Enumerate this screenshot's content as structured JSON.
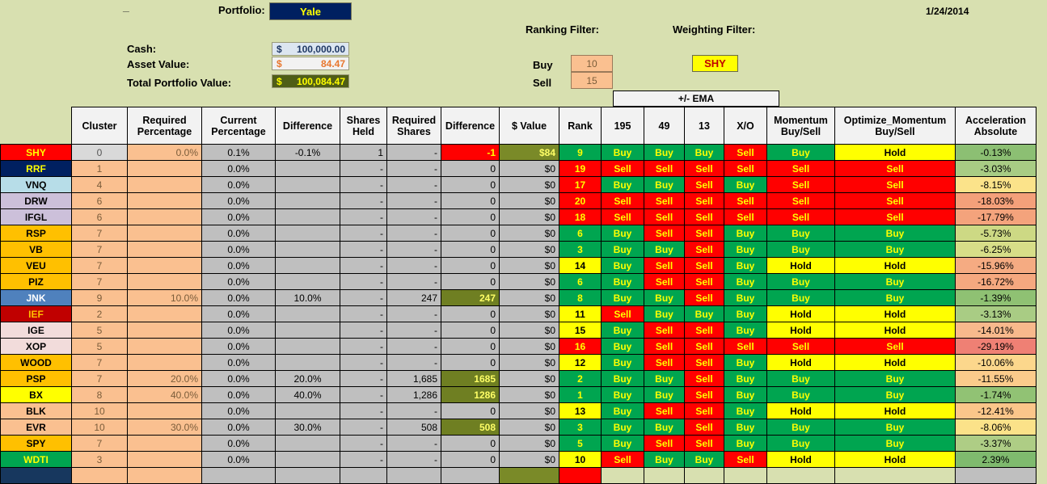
{
  "header": {
    "dash": "_",
    "portfolio_label": "Portfolio:",
    "portfolio_name": "Yale",
    "date": "1/24/2014",
    "cash_label": "Cash:",
    "cash_currency": "$",
    "cash_value": "100,000.00",
    "asset_label": "Asset Value:",
    "asset_currency": "$",
    "asset_value": "84.47",
    "total_label": "Total Portfolio Value:",
    "total_currency": "$",
    "total_value": "100,084.47",
    "ranking_filter_label": "Ranking Filter:",
    "weighting_filter_label": "Weighting Filter:",
    "buy_label": "Buy",
    "buy_value": "10",
    "sell_label": "Sell",
    "sell_value": "15",
    "weighting_filter_value": "SHY"
  },
  "table": {
    "group_header_ema": "+/- EMA",
    "columns": [
      "",
      "Cluster",
      "Required\nPercentage",
      "Current\nPercentage",
      "Difference",
      "Shares\nHeld",
      "Required\nShares",
      "Difference",
      "$ Value",
      "Rank",
      "195",
      "49",
      "13",
      "X/O",
      "Momentum\nBuy/Sell",
      "Optimize_Momentum\nBuy/Sell",
      "Acceleration\nAbsolute"
    ],
    "columns_flat": {
      "ticker": "",
      "cluster": "Cluster",
      "required_percentage_l1": "Required",
      "required_percentage_l2": "Percentage",
      "current_percentage_l1": "Current",
      "current_percentage_l2": "Percentage",
      "difference_pct": "Difference",
      "shares_held_l1": "Shares",
      "shares_held_l2": "Held",
      "required_shares_l1": "Required",
      "required_shares_l2": "Shares",
      "difference_shares": "Difference",
      "dollar_value": "$ Value",
      "rank": "Rank",
      "ema195": "195",
      "ema49": "49",
      "ema13": "13",
      "xo": "X/O",
      "momentum_l1": "Momentum",
      "momentum_l2": "Buy/Sell",
      "optimize_momentum_l1": "Optimize_Momentum",
      "optimize_momentum_l2": "Buy/Sell",
      "acceleration_l1": "Acceleration",
      "acceleration_l2": "Absolute"
    },
    "rows": [
      {
        "ticker": "SHY",
        "ticker_bg": "#ff0000",
        "ticker_fg": "#ffff00",
        "cluster": "0",
        "cluster_sel": true,
        "req_pct": "0.0%",
        "cur_pct": "0.1%",
        "diff_pct": "-0.1%",
        "shares_held": "1",
        "req_shares": "-",
        "diff_shares": "-1",
        "diff_shares_style": "red",
        "value": "$84",
        "value_style": "olive",
        "rank": "9",
        "rank_color": "g",
        "ema195": "Buy",
        "ema49": "Buy",
        "ema13": "Buy",
        "xo": "Sell",
        "momentum": "Buy",
        "opt_momentum": "Hold",
        "accel": "-0.13%",
        "accel_bg": "#8cbf73"
      },
      {
        "ticker": "RRF",
        "ticker_bg": "#002060",
        "ticker_fg": "#ffff00",
        "cluster": "1",
        "req_pct": "",
        "cur_pct": "0.0%",
        "diff_pct": "",
        "shares_held": "-",
        "req_shares": "-",
        "diff_shares": "0",
        "value": "$0",
        "rank": "19",
        "rank_color": "r",
        "ema195": "Sell",
        "ema49": "Sell",
        "ema13": "Sell",
        "xo": "Sell",
        "momentum": "Sell",
        "opt_momentum": "Sell",
        "accel": "-3.03%",
        "accel_bg": "#a8cc84"
      },
      {
        "ticker": "VNQ",
        "ticker_bg": "#b7dde8",
        "ticker_fg": "#000000",
        "cluster": "4",
        "req_pct": "",
        "cur_pct": "0.0%",
        "diff_pct": "",
        "shares_held": "-",
        "req_shares": "-",
        "diff_shares": "0",
        "value": "$0",
        "rank": "17",
        "rank_color": "r",
        "ema195": "Buy",
        "ema49": "Buy",
        "ema13": "Sell",
        "xo": "Buy",
        "momentum": "Sell",
        "opt_momentum": "Sell",
        "accel": "-8.15%",
        "accel_bg": "#fbe38a"
      },
      {
        "ticker": "DRW",
        "ticker_bg": "#ccc0da",
        "ticker_fg": "#000000",
        "cluster": "6",
        "req_pct": "",
        "cur_pct": "0.0%",
        "diff_pct": "",
        "shares_held": "-",
        "req_shares": "-",
        "diff_shares": "0",
        "value": "$0",
        "rank": "20",
        "rank_color": "r",
        "ema195": "Sell",
        "ema49": "Sell",
        "ema13": "Sell",
        "xo": "Sell",
        "momentum": "Sell",
        "opt_momentum": "Sell",
        "accel": "-18.03%",
        "accel_bg": "#f4a07a"
      },
      {
        "ticker": "IFGL",
        "ticker_bg": "#ccc0da",
        "ticker_fg": "#000000",
        "cluster": "6",
        "req_pct": "",
        "cur_pct": "0.0%",
        "diff_pct": "",
        "shares_held": "-",
        "req_shares": "-",
        "diff_shares": "0",
        "value": "$0",
        "rank": "18",
        "rank_color": "r",
        "ema195": "Sell",
        "ema49": "Sell",
        "ema13": "Sell",
        "xo": "Sell",
        "momentum": "Sell",
        "opt_momentum": "Sell",
        "accel": "-17.79%",
        "accel_bg": "#f4a37c"
      },
      {
        "ticker": "RSP",
        "ticker_bg": "#ffc000",
        "ticker_fg": "#000000",
        "cluster": "7",
        "req_pct": "",
        "cur_pct": "0.0%",
        "diff_pct": "",
        "shares_held": "-",
        "req_shares": "-",
        "diff_shares": "0",
        "value": "$0",
        "rank": "6",
        "rank_color": "g",
        "ema195": "Buy",
        "ema49": "Sell",
        "ema13": "Sell",
        "xo": "Buy",
        "momentum": "Buy",
        "opt_momentum": "Buy",
        "accel": "-5.73%",
        "accel_bg": "#cdd984"
      },
      {
        "ticker": "VB",
        "ticker_bg": "#ffc000",
        "ticker_fg": "#000000",
        "cluster": "7",
        "req_pct": "",
        "cur_pct": "0.0%",
        "diff_pct": "",
        "shares_held": "-",
        "req_shares": "-",
        "diff_shares": "0",
        "value": "$0",
        "rank": "3",
        "rank_color": "g",
        "ema195": "Buy",
        "ema49": "Buy",
        "ema13": "Sell",
        "xo": "Buy",
        "momentum": "Buy",
        "opt_momentum": "Buy",
        "accel": "-6.25%",
        "accel_bg": "#d7de88"
      },
      {
        "ticker": "VEU",
        "ticker_bg": "#ffc000",
        "ticker_fg": "#000000",
        "cluster": "7",
        "req_pct": "",
        "cur_pct": "0.0%",
        "diff_pct": "",
        "shares_held": "-",
        "req_shares": "-",
        "diff_shares": "0",
        "value": "$0",
        "rank": "14",
        "rank_color": "y",
        "ema195": "Buy",
        "ema49": "Sell",
        "ema13": "Sell",
        "xo": "Buy",
        "momentum": "Hold",
        "opt_momentum": "Hold",
        "accel": "-15.96%",
        "accel_bg": "#f5ab82"
      },
      {
        "ticker": "PIZ",
        "ticker_bg": "#ffc000",
        "ticker_fg": "#000000",
        "cluster": "7",
        "req_pct": "",
        "cur_pct": "0.0%",
        "diff_pct": "",
        "shares_held": "-",
        "req_shares": "-",
        "diff_shares": "0",
        "value": "$0",
        "rank": "6",
        "rank_color": "g",
        "ema195": "Buy",
        "ema49": "Sell",
        "ema13": "Sell",
        "xo": "Buy",
        "momentum": "Buy",
        "opt_momentum": "Buy",
        "accel": "-16.72%",
        "accel_bg": "#f5a87f"
      },
      {
        "ticker": "JNK",
        "ticker_bg": "#4f81bd",
        "ticker_fg": "#ffffff",
        "cluster": "9",
        "req_pct": "10.0%",
        "cur_pct": "0.0%",
        "diff_pct": "10.0%",
        "shares_held": "-",
        "req_shares": "247",
        "diff_shares": "247",
        "diff_shares_style": "olive",
        "value": "$0",
        "rank": "8",
        "rank_color": "g",
        "ema195": "Buy",
        "ema49": "Buy",
        "ema13": "Sell",
        "xo": "Buy",
        "momentum": "Buy",
        "opt_momentum": "Buy",
        "accel": "-1.39%",
        "accel_bg": "#8fc173"
      },
      {
        "ticker": "IEF",
        "ticker_bg": "#c00000",
        "ticker_fg": "#ffc000",
        "cluster": "2",
        "req_pct": "",
        "cur_pct": "0.0%",
        "diff_pct": "",
        "shares_held": "-",
        "req_shares": "-",
        "diff_shares": "0",
        "value": "$0",
        "rank": "11",
        "rank_color": "y",
        "ema195": "Sell",
        "ema49": "Buy",
        "ema13": "Buy",
        "xo": "Buy",
        "momentum": "Hold",
        "opt_momentum": "Hold",
        "accel": "-3.13%",
        "accel_bg": "#a9cc84"
      },
      {
        "ticker": "IGE",
        "ticker_bg": "#f2dcdb",
        "ticker_fg": "#000000",
        "cluster": "5",
        "req_pct": "",
        "cur_pct": "0.0%",
        "diff_pct": "",
        "shares_held": "-",
        "req_shares": "-",
        "diff_shares": "0",
        "value": "$0",
        "rank": "15",
        "rank_color": "y",
        "ema195": "Buy",
        "ema49": "Sell",
        "ema13": "Sell",
        "xo": "Buy",
        "momentum": "Hold",
        "opt_momentum": "Hold",
        "accel": "-14.01%",
        "accel_bg": "#f8b98c"
      },
      {
        "ticker": "XOP",
        "ticker_bg": "#f2dcdb",
        "ticker_fg": "#000000",
        "cluster": "5",
        "req_pct": "",
        "cur_pct": "0.0%",
        "diff_pct": "",
        "shares_held": "-",
        "req_shares": "-",
        "diff_shares": "0",
        "value": "$0",
        "rank": "16",
        "rank_color": "r",
        "ema195": "Buy",
        "ema49": "Sell",
        "ema13": "Sell",
        "xo": "Sell",
        "momentum": "Sell",
        "opt_momentum": "Sell",
        "accel": "-29.19%",
        "accel_bg": "#ef8074"
      },
      {
        "ticker": "WOOD",
        "ticker_bg": "#ffc000",
        "ticker_fg": "#000000",
        "cluster": "7",
        "req_pct": "",
        "cur_pct": "0.0%",
        "diff_pct": "",
        "shares_held": "-",
        "req_shares": "-",
        "diff_shares": "0",
        "value": "$0",
        "rank": "12",
        "rank_color": "y",
        "ema195": "Buy",
        "ema49": "Sell",
        "ema13": "Sell",
        "xo": "Buy",
        "momentum": "Hold",
        "opt_momentum": "Hold",
        "accel": "-10.06%",
        "accel_bg": "#fcd78c"
      },
      {
        "ticker": "PSP",
        "ticker_bg": "#ffc000",
        "ticker_fg": "#000000",
        "cluster": "7",
        "req_pct": "20.0%",
        "cur_pct": "0.0%",
        "diff_pct": "20.0%",
        "shares_held": "-",
        "req_shares": "1,685",
        "diff_shares": "1685",
        "diff_shares_style": "olive",
        "value": "$0",
        "rank": "2",
        "rank_color": "g",
        "ema195": "Buy",
        "ema49": "Buy",
        "ema13": "Sell",
        "xo": "Buy",
        "momentum": "Buy",
        "opt_momentum": "Buy",
        "accel": "-11.55%",
        "accel_bg": "#fbcb8b"
      },
      {
        "ticker": "BX",
        "ticker_bg": "#ffff00",
        "ticker_fg": "#000000",
        "cluster": "8",
        "req_pct": "40.0%",
        "cur_pct": "0.0%",
        "diff_pct": "40.0%",
        "shares_held": "-",
        "req_shares": "1,286",
        "diff_shares": "1286",
        "diff_shares_style": "olive",
        "value": "$0",
        "rank": "1",
        "rank_color": "g",
        "ema195": "Buy",
        "ema49": "Buy",
        "ema13": "Sell",
        "xo": "Buy",
        "momentum": "Buy",
        "opt_momentum": "Buy",
        "accel": "-1.74%",
        "accel_bg": "#91c274"
      },
      {
        "ticker": "BLK",
        "ticker_bg": "#fac090",
        "ticker_fg": "#000000",
        "cluster": "10",
        "req_pct": "",
        "cur_pct": "0.0%",
        "diff_pct": "",
        "shares_held": "-",
        "req_shares": "-",
        "diff_shares": "0",
        "value": "$0",
        "rank": "13",
        "rank_color": "y",
        "ema195": "Buy",
        "ema49": "Sell",
        "ema13": "Sell",
        "xo": "Buy",
        "momentum": "Hold",
        "opt_momentum": "Hold",
        "accel": "-12.41%",
        "accel_bg": "#fbc68a"
      },
      {
        "ticker": "EVR",
        "ticker_bg": "#fac090",
        "ticker_fg": "#000000",
        "cluster": "10",
        "req_pct": "30.0%",
        "cur_pct": "0.0%",
        "diff_pct": "30.0%",
        "shares_held": "-",
        "req_shares": "508",
        "diff_shares": "508",
        "diff_shares_style": "olive",
        "value": "$0",
        "rank": "3",
        "rank_color": "g",
        "ema195": "Buy",
        "ema49": "Buy",
        "ema13": "Sell",
        "xo": "Buy",
        "momentum": "Buy",
        "opt_momentum": "Buy",
        "accel": "-8.06%",
        "accel_bg": "#fbe289"
      },
      {
        "ticker": "SPY",
        "ticker_bg": "#ffc000",
        "ticker_fg": "#000000",
        "cluster": "7",
        "req_pct": "",
        "cur_pct": "0.0%",
        "diff_pct": "",
        "shares_held": "-",
        "req_shares": "-",
        "diff_shares": "0",
        "value": "$0",
        "rank": "5",
        "rank_color": "g",
        "ema195": "Buy",
        "ema49": "Sell",
        "ema13": "Sell",
        "xo": "Buy",
        "momentum": "Buy",
        "opt_momentum": "Buy",
        "accel": "-3.37%",
        "accel_bg": "#aecd85"
      },
      {
        "ticker": "WDTI",
        "ticker_bg": "#00a550",
        "ticker_fg": "#ffff00",
        "cluster": "3",
        "req_pct": "",
        "cur_pct": "0.0%",
        "diff_pct": "",
        "shares_held": "-",
        "req_shares": "-",
        "diff_shares": "0",
        "value": "$0",
        "rank": "10",
        "rank_color": "y",
        "ema195": "Sell",
        "ema49": "Buy",
        "ema13": "Buy",
        "xo": "Sell",
        "momentum": "Hold",
        "opt_momentum": "Hold",
        "accel": "2.39%",
        "accel_bg": "#7fba6e"
      },
      {
        "ticker": "",
        "ticker_bg": "#17375e",
        "ticker_fg": "#ffffff",
        "cluster": "",
        "req_pct": "",
        "cur_pct": "",
        "diff_pct": "",
        "shares_held": "",
        "req_shares": "",
        "diff_shares": "",
        "value": "",
        "value_style": "olive",
        "rank": "",
        "rank_color": "r",
        "ema195": "",
        "ema49": "",
        "ema13": "",
        "xo": "",
        "momentum": "",
        "opt_momentum": "",
        "accel": "",
        "accel_bg": "#bfbfbf",
        "partial": true
      }
    ]
  }
}
